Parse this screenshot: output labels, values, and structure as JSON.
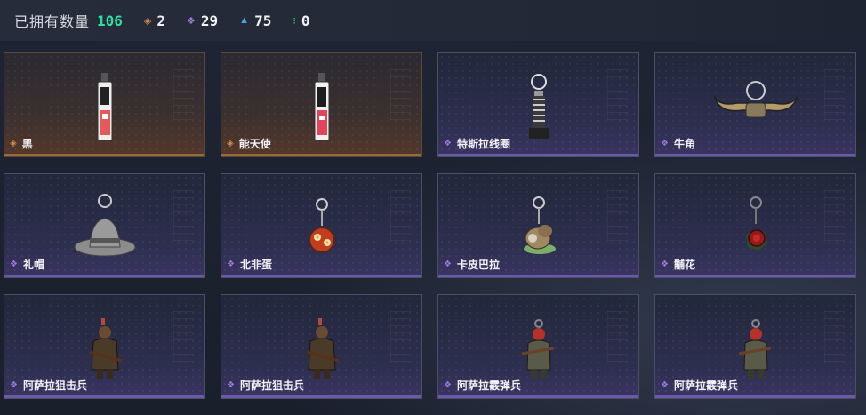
{
  "header": {
    "owned_label": "已拥有数量",
    "owned_count": "106",
    "stats": [
      {
        "icon": "orange-rarity-icon",
        "color": "#d88a4a",
        "value": "2"
      },
      {
        "icon": "purple-rarity-icon",
        "color": "#9d7ae0",
        "value": "29"
      },
      {
        "icon": "blue-rarity-icon",
        "color": "#4aa6e0",
        "value": "75"
      },
      {
        "icon": "green-rarity-icon",
        "color": "#2fe0a2",
        "value": "0"
      }
    ]
  },
  "items": [
    {
      "name": "黑",
      "rarity": "orange",
      "icon": "card-tag-pendant-icon"
    },
    {
      "name": "能天使",
      "rarity": "orange",
      "icon": "card-tag-pendant-icon"
    },
    {
      "name": "特斯拉线圈",
      "rarity": "purple",
      "icon": "tesla-coil-pendant-icon"
    },
    {
      "name": "牛角",
      "rarity": "purple",
      "icon": "bull-horn-pendant-icon"
    },
    {
      "name": "礼帽",
      "rarity": "purple",
      "icon": "top-hat-pendant-icon"
    },
    {
      "name": "北非蛋",
      "rarity": "purple",
      "icon": "shakshuka-pendant-icon"
    },
    {
      "name": "卡皮巴拉",
      "rarity": "purple",
      "icon": "capybara-pendant-icon"
    },
    {
      "name": "黼花",
      "rarity": "purple",
      "icon": "flower-pendant-icon"
    },
    {
      "name": "阿萨拉狙击兵",
      "rarity": "purple",
      "icon": "sniper-figure-icon"
    },
    {
      "name": "阿萨拉狙击兵",
      "rarity": "purple",
      "icon": "sniper-figure-icon"
    },
    {
      "name": "阿萨拉霰弹兵",
      "rarity": "purple",
      "icon": "shotgunner-figure-icon"
    },
    {
      "name": "阿萨拉霰弹兵",
      "rarity": "purple",
      "icon": "shotgunner-figure-icon"
    }
  ]
}
